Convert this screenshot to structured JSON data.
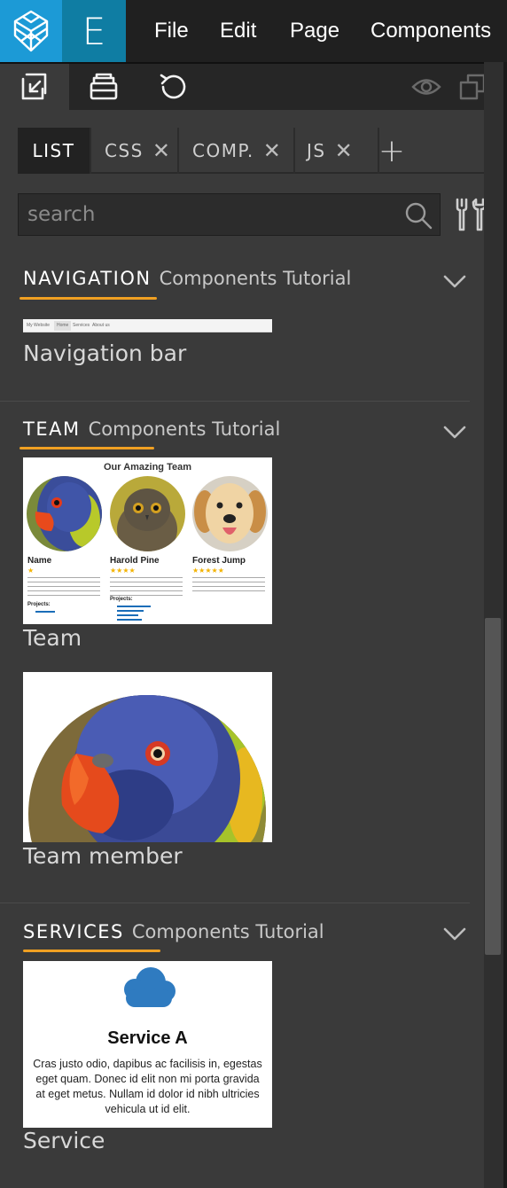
{
  "menu": {
    "logo_letter": "E",
    "items": [
      "File",
      "Edit",
      "Page",
      "Components"
    ]
  },
  "tabs": [
    {
      "label": "LIST",
      "active": true
    },
    {
      "label": "CSS",
      "close": "✕"
    },
    {
      "label": "COMP.",
      "close": "✕"
    },
    {
      "label": "JS",
      "close": "✕"
    }
  ],
  "tab_add": "+",
  "search": {
    "placeholder": "search"
  },
  "sections": [
    {
      "title": "NAVIGATION",
      "subtitle": "Components Tutorial",
      "items": [
        {
          "label": "Navigation bar",
          "thumb": {
            "brand": "My Website",
            "links": [
              "Home",
              "Services",
              "About us"
            ]
          }
        }
      ]
    },
    {
      "title": "TEAM",
      "subtitle": "Components Tutorial",
      "items": [
        {
          "label": "Team",
          "thumb": {
            "heading": "Our Amazing Team",
            "members": [
              {
                "name": "Name",
                "stars": "★"
              },
              {
                "name": "Harold Pine",
                "stars": "★★★★"
              },
              {
                "name": "Forest Jump",
                "stars": "★★★★★"
              }
            ],
            "projects_label": "Projects:"
          }
        },
        {
          "label": "Team member"
        }
      ]
    },
    {
      "title": "SERVICES",
      "subtitle": "Components Tutorial",
      "items": [
        {
          "label": "Service",
          "thumb": {
            "title": "Service A",
            "text": "Cras justo odio, dapibus ac facilisis in, egestas eget quam. Donec id elit non mi porta gravida at eget metus. Nullam id dolor id nibh ultricies vehicula ut id elit."
          }
        }
      ]
    }
  ],
  "colors": {
    "accent_underline": "#f0a022",
    "pine_blue": "#1c9ad6",
    "e_blue": "#0f7da3",
    "panel": "#3a3a3a"
  }
}
